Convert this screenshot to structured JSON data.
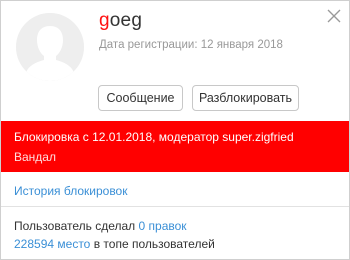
{
  "profile": {
    "username_first": "g",
    "username_rest": "oeg",
    "registration": "Дата регистрации: 12 января 2018"
  },
  "actions": {
    "message_label": "Сообщение",
    "unblock_label": "Разблокировать"
  },
  "block": {
    "title": "Блокировка с 12.01.2018, модератор super.zigfried",
    "reason": "Вандал",
    "banner_color": "#ff0000"
  },
  "history": {
    "link_label": "История блокировок"
  },
  "stats": {
    "edits_prefix": "Пользователь сделал",
    "edits_count": "0",
    "edits_suffix": "правок",
    "rank_number": "228594",
    "rank_word": "место",
    "rank_suffix": "в топе пользователей"
  },
  "icons": {
    "close": "close-icon",
    "avatar": "default-avatar-icon"
  },
  "colors": {
    "link": "#3a8fd6",
    "username_accent": "#ff1111"
  }
}
